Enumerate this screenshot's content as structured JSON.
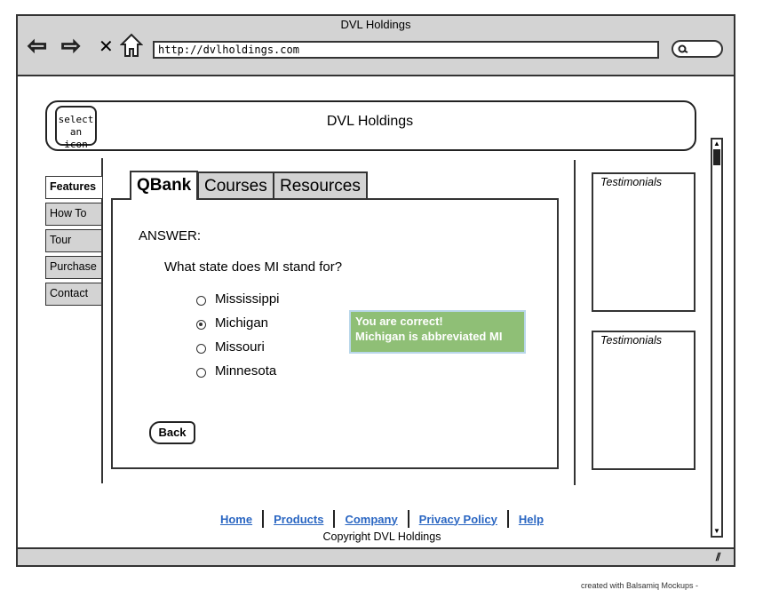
{
  "window": {
    "title": "DVL Holdings",
    "url": "http://dvlholdings.com"
  },
  "header": {
    "icon_placeholder": "select an icon",
    "title": "DVL Holdings"
  },
  "sidebar": {
    "items": [
      {
        "label": "Features"
      },
      {
        "label": "How To"
      },
      {
        "label": "Tour"
      },
      {
        "label": "Purchase"
      },
      {
        "label": "Contact"
      }
    ]
  },
  "tabs": [
    {
      "label": "QBank"
    },
    {
      "label": "Courses"
    },
    {
      "label": "Resources"
    }
  ],
  "quiz": {
    "heading": "ANSWER:",
    "question": "What state does MI stand for?",
    "options": [
      {
        "label": "Mississippi",
        "selected": false
      },
      {
        "label": "Michigan",
        "selected": true
      },
      {
        "label": "Missouri",
        "selected": false
      },
      {
        "label": "Minnesota",
        "selected": false
      }
    ],
    "feedback_line1": "You are correct!",
    "feedback_line2": "Michigan is abbreviated MI",
    "back_label": "Back"
  },
  "testimonials": [
    {
      "title": "Testimonials"
    },
    {
      "title": "Testimonials"
    }
  ],
  "footer": {
    "links": [
      "Home",
      "Products",
      "Company",
      "Privacy Policy",
      "Help"
    ],
    "copyright": "Copyright DVL Holdings"
  },
  "credit": "created with Balsamiq Mockups -",
  "colors": {
    "feedback_bg": "#8fbf76",
    "link": "#2a66c2",
    "chrome": "#d3d3d3"
  }
}
